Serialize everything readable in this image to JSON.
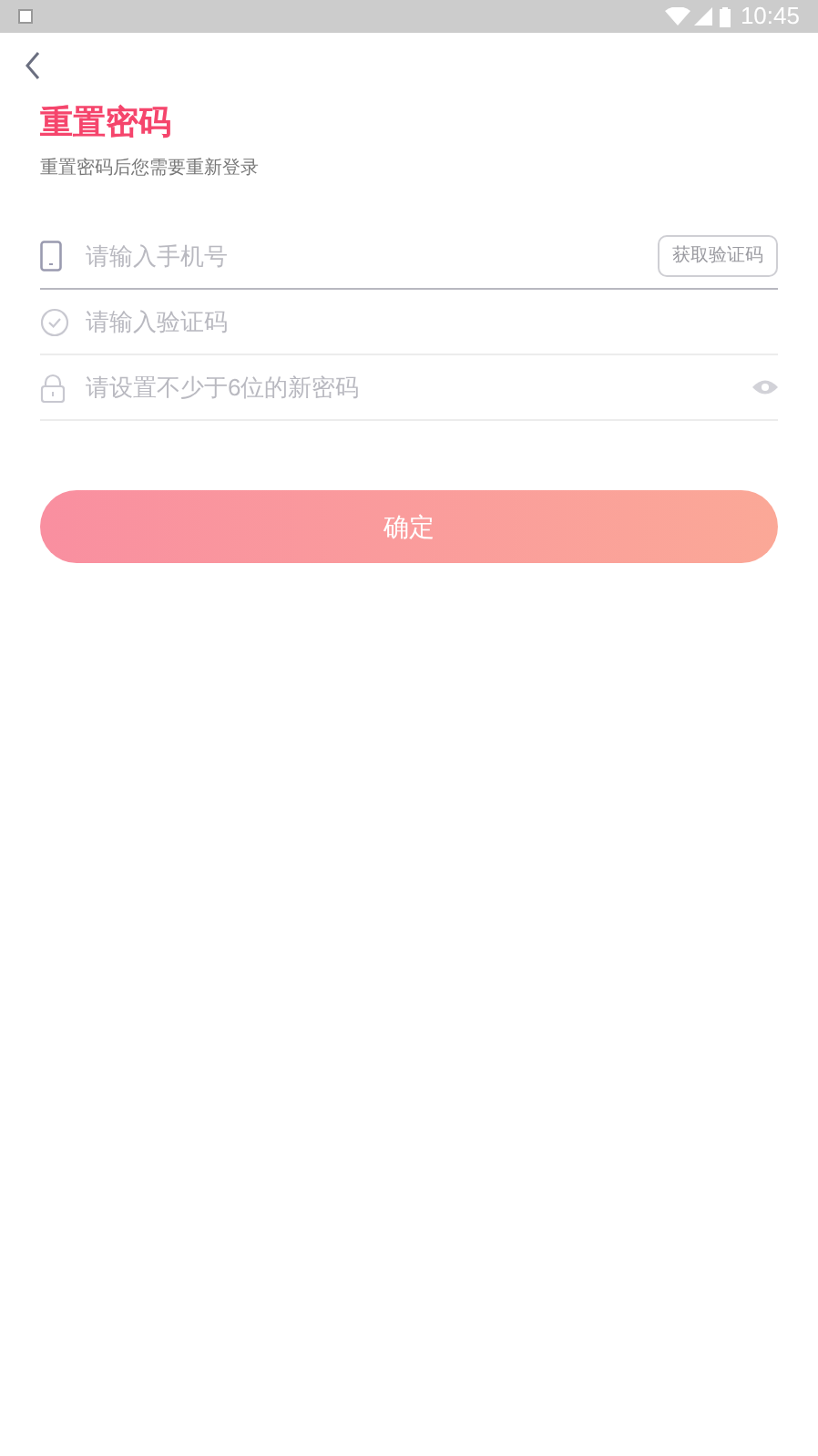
{
  "status_bar": {
    "time": "10:45"
  },
  "title": "重置密码",
  "subtitle": "重置密码后您需要重新登录",
  "fields": [
    {
      "kind": "phone",
      "placeholder": "请输入手机号",
      "focused": true,
      "action": "获取验证码"
    },
    {
      "kind": "code",
      "placeholder": "请输入验证码",
      "focused": false
    },
    {
      "kind": "password",
      "placeholder": "请设置不少于6位的新密码",
      "focused": false
    }
  ],
  "submit": "确定"
}
